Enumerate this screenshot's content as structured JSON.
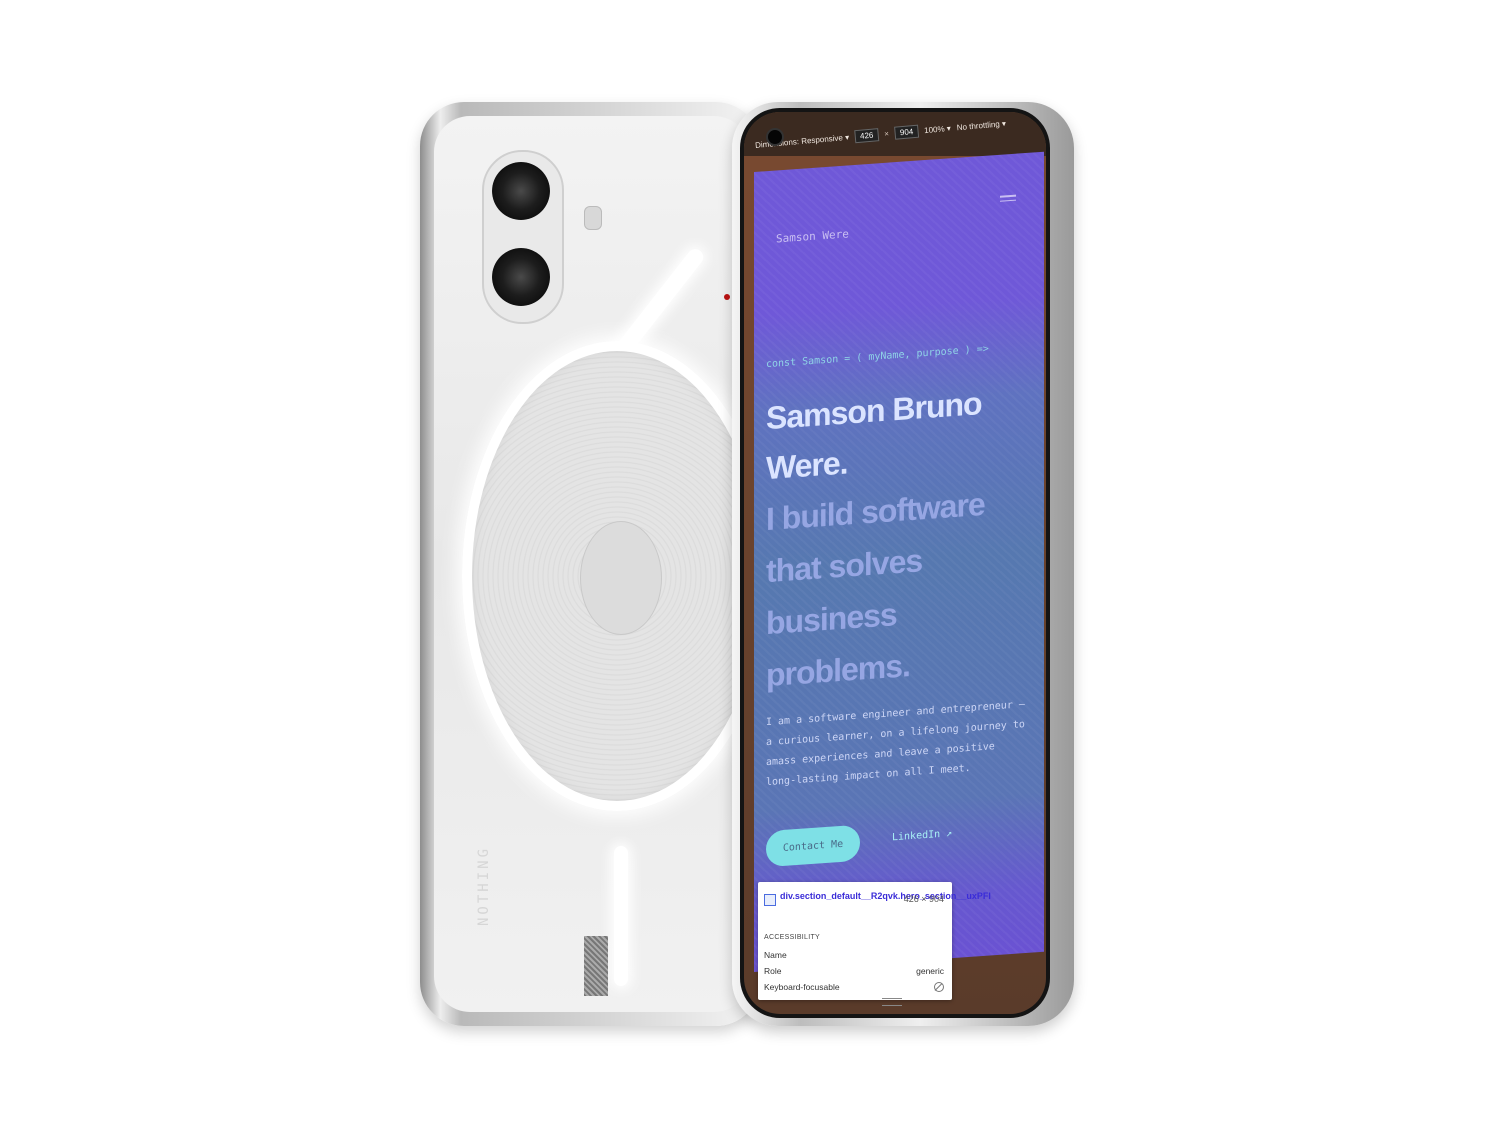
{
  "back_phone": {
    "brand": "NOTHING"
  },
  "devtools": {
    "dimensions_label": "Dimensions: Responsive ▾",
    "width_value": "426",
    "times_sign": "×",
    "height_value": "904",
    "zoom": "100% ▾",
    "throttling": "No throttling ▾"
  },
  "website": {
    "site_name": "Samson Were",
    "code_line": "const Samson = ( myName, purpose ) =>",
    "hero_name": "Samson Bruno Were.",
    "hero_tagline": "I build software that solves business problems.",
    "intro": "I am a software engineer and entrepreneur — a curious learner, on a lifelong journey to amass experiences and leave a positive long-lasting impact on all I meet.",
    "contact_button": "Contact Me",
    "linkedin_link": "LinkedIn ↗"
  },
  "inspector": {
    "selector": "div.section_default__R2qvk.hero_section__uxPFI",
    "size": "426 × 904",
    "section_heading": "ACCESSIBILITY",
    "rows": [
      {
        "label": "Name",
        "value": ""
      },
      {
        "label": "Role",
        "value": "generic"
      },
      {
        "label": "Keyboard-focusable",
        "value": ""
      }
    ]
  },
  "colors": {
    "hero_purple": "#6f58d8",
    "accent_cyan": "#7ee0e6",
    "selector_blue": "#3a2cd8"
  }
}
